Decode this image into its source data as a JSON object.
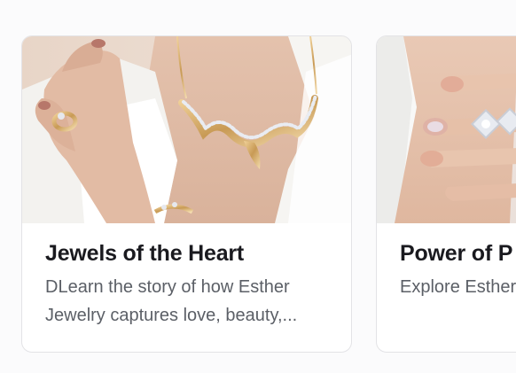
{
  "cards": [
    {
      "title": "Jewels of the Heart",
      "description": "DLearn the story of how Esther Jewelry captures love, beauty,...",
      "image_subject": "necklace-bracelet-ring-photo"
    },
    {
      "title": "Power of P",
      "description": "Explore Esther customizable",
      "image_subject": "hand-rings-photo"
    }
  ],
  "colors": {
    "card_bg": "#ffffff",
    "card_border": "#e3e3e6",
    "title": "#1a1a1f",
    "description": "#5b5f66",
    "page_bg": "#fbfbfc"
  }
}
